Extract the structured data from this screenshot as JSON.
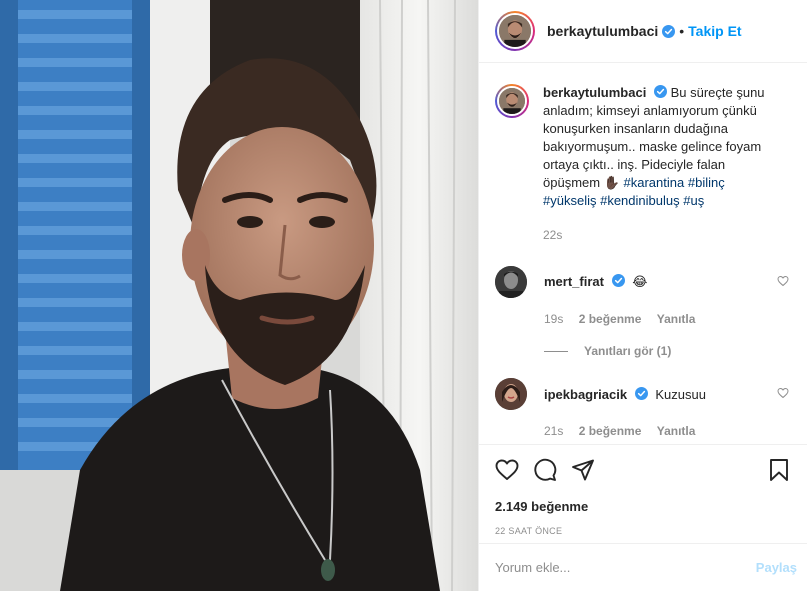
{
  "post": {
    "username": "berkaytulumbaci",
    "follow_separator": "•",
    "follow_label": "Takip Et",
    "caption": {
      "text": "Bu süreçte şunu anladım; kimseyi anlamıyorum çünkü konuşurken insanların dudağına bakıyormuşum.. maske gelince foyam ortaya çıktı.. inş. Pideciyle falan öpüşmem",
      "emoji": "✋🏿",
      "hashtags": [
        "#karantina",
        "#bilinç",
        "#yükseliş",
        "#kendinibuluş",
        "#uş"
      ],
      "time": "22s"
    },
    "comments": [
      {
        "username": "mert_firat",
        "text": "😂",
        "time": "19s",
        "likes": "2 beğenme",
        "reply": "Yanıtla",
        "view_replies": "Yanıtları gör (1)"
      },
      {
        "username": "ipekbagriacik",
        "text": "Kuzusuu",
        "time": "21s",
        "likes": "2 beğenme",
        "reply": "Yanıtla"
      }
    ],
    "likes_count": "2.149 beğenme",
    "date": "22 SAAT ÖNCE",
    "add_comment_placeholder": "Yorum ekle...",
    "post_button": "Paylaş"
  },
  "colors": {
    "link_blue": "#0095f6",
    "hashtag_blue": "#00376b",
    "muted_gray": "#8e8e8e",
    "shutter_blue": "#3d7fc4"
  }
}
